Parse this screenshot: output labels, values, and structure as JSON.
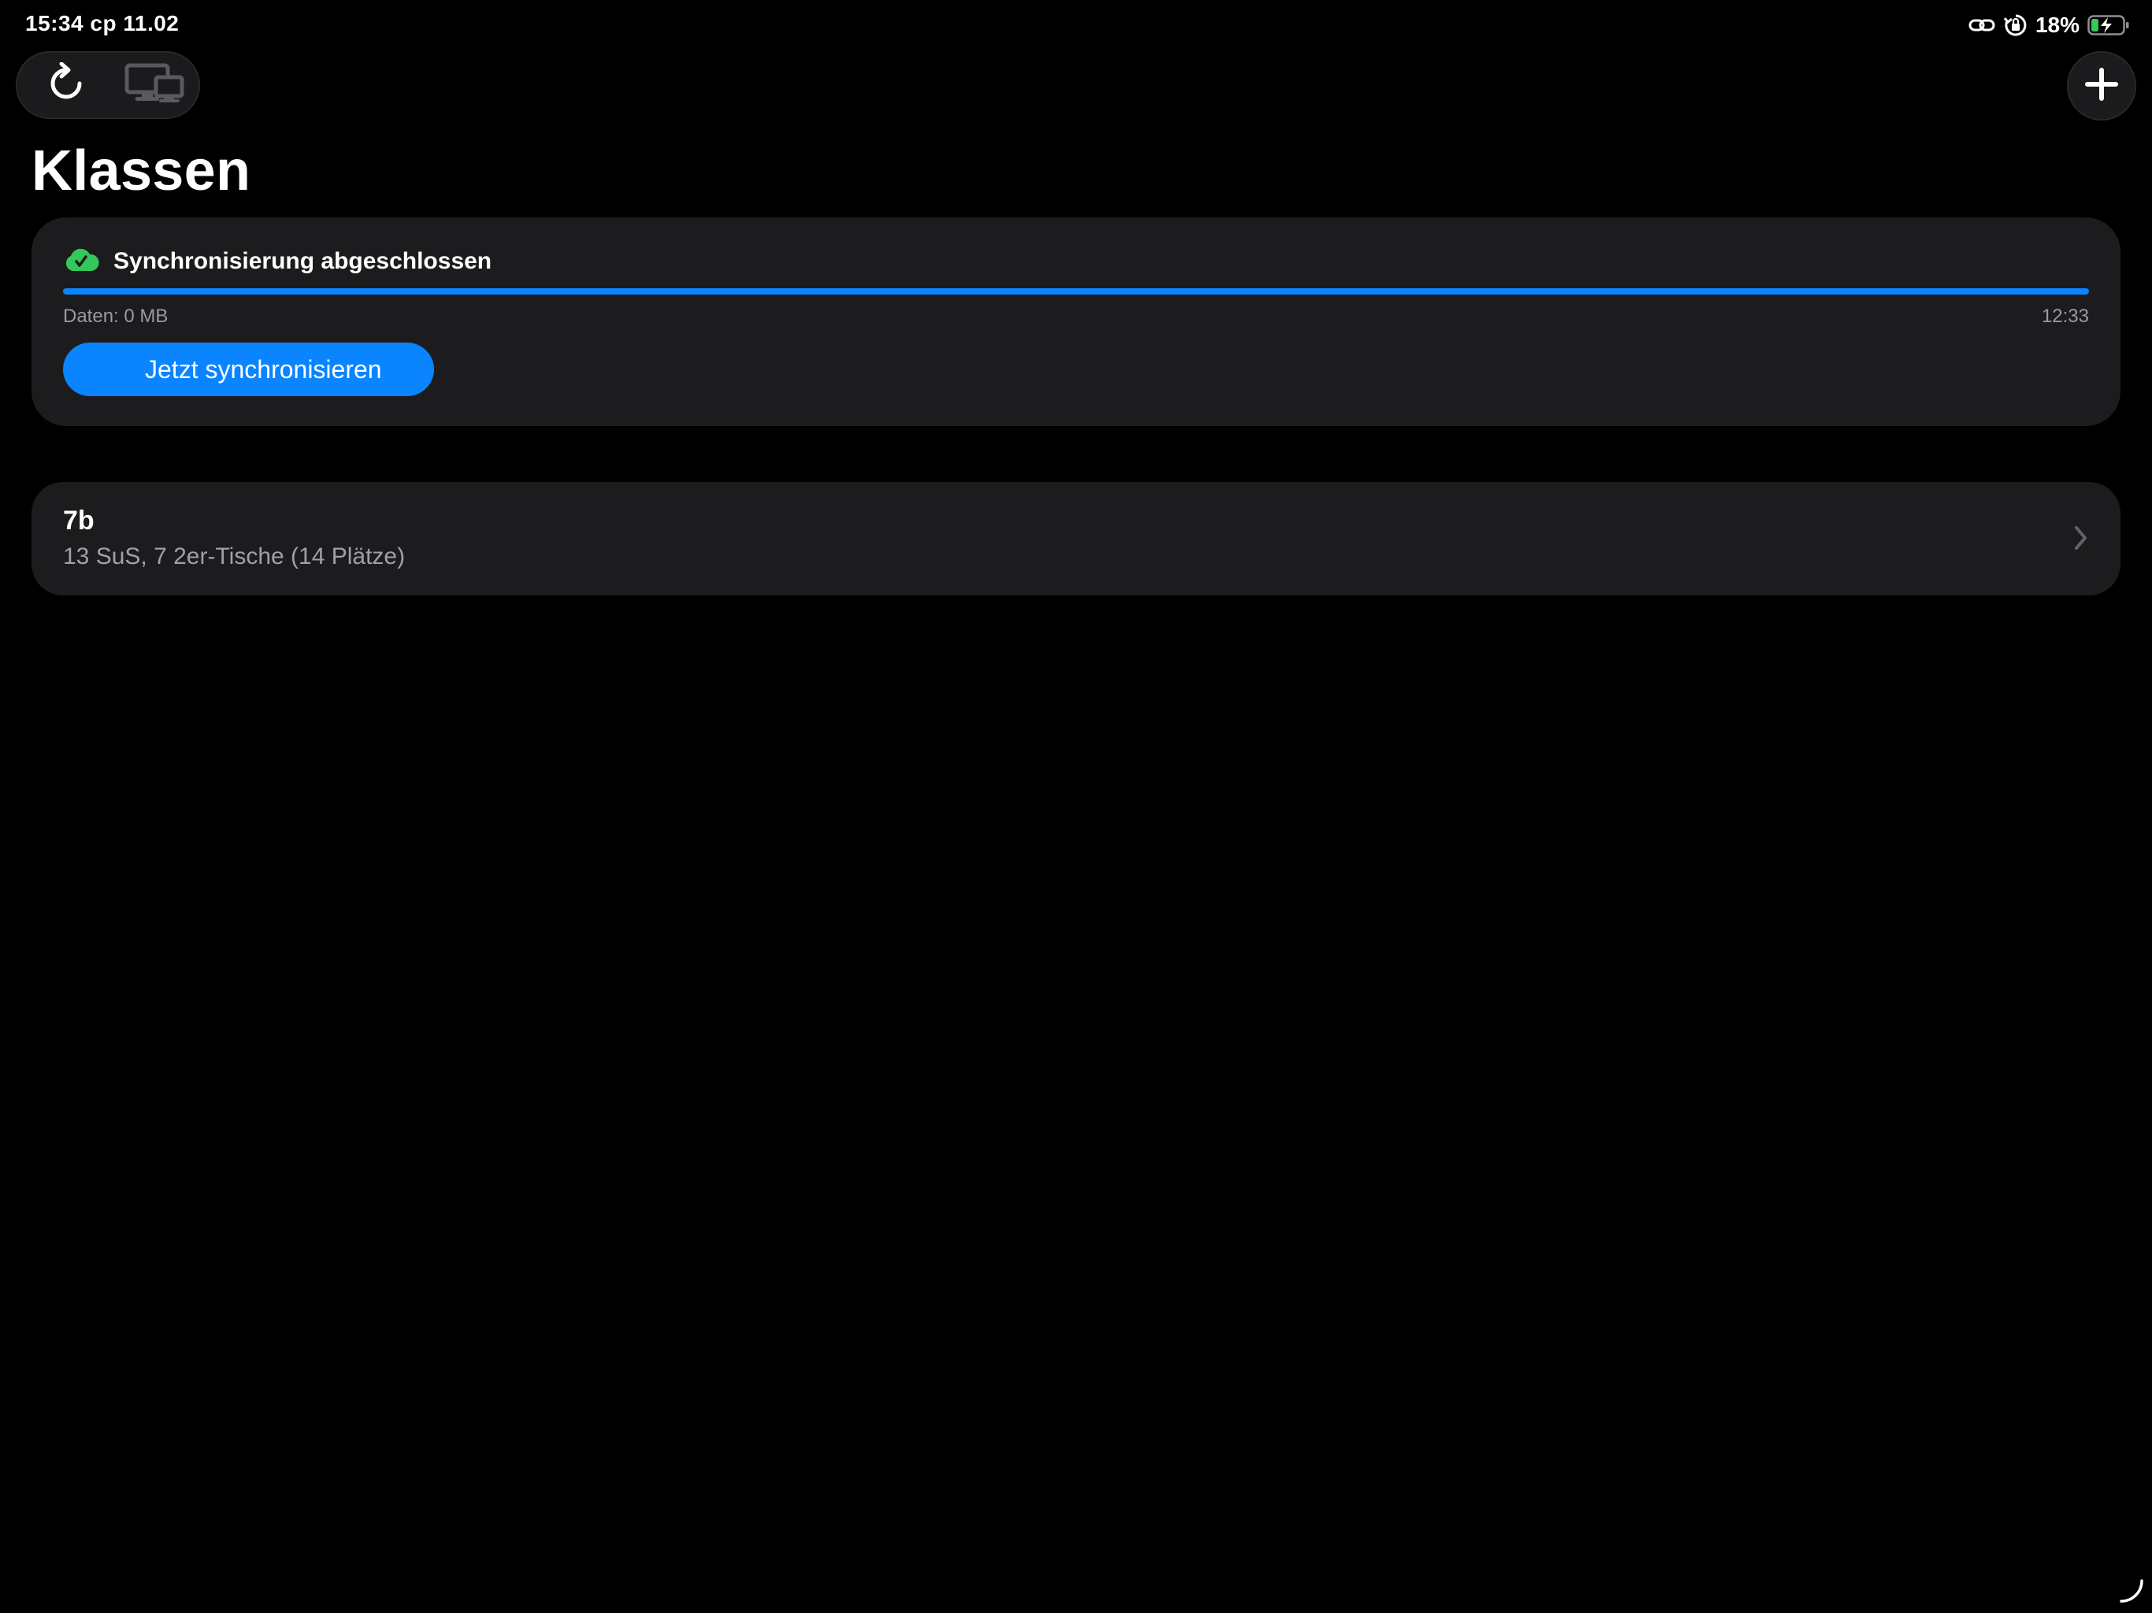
{
  "status_bar": {
    "time_date": "15:34   cp 11.02",
    "battery_percent": "18%",
    "battery_level": 0.18,
    "icons": [
      "link-icon",
      "orientation-lock-icon",
      "battery-charging-icon"
    ]
  },
  "toolbar": {
    "icons": [
      "refresh-icon",
      "devices-icon",
      "plus-icon"
    ]
  },
  "page": {
    "title": "Klassen"
  },
  "sync": {
    "status_icon": "cloud-check-icon",
    "title": "Synchronisierung abgeschlossen",
    "progress": 1.0,
    "data_label": "Daten: 0 MB",
    "time_label": "12:33",
    "button_label": "Jetzt synchronisieren"
  },
  "classes": [
    {
      "name": "7b",
      "detail": "13 SuS, 7 2er-Tische (14 Plätze)"
    }
  ],
  "colors": {
    "background": "#000000",
    "card": "#1c1c1e",
    "accent": "#0a84ff",
    "success": "#34c759",
    "secondary_text": "#9a9aa0"
  }
}
